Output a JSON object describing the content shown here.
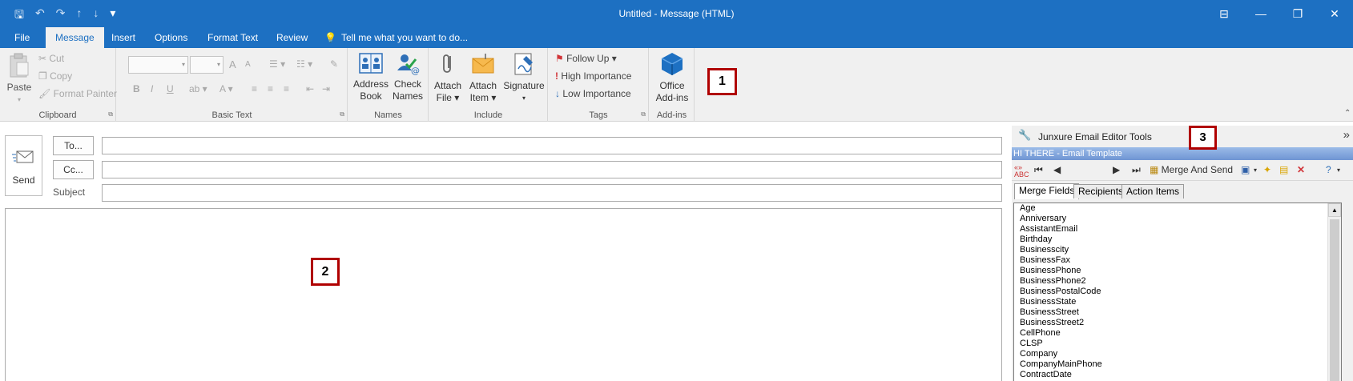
{
  "window": {
    "title": "Untitled  -  Message (HTML)",
    "qat": {
      "save": "🖫",
      "undo": "↶",
      "redo": "↷",
      "up": "↑",
      "down": "↓",
      "customize": "▾"
    },
    "controls": {
      "ribbon_display": "⊟",
      "minimize": "—",
      "restore": "❐",
      "close": "✕"
    }
  },
  "tabs": {
    "file": "File",
    "message": "Message",
    "insert": "Insert",
    "options": "Options",
    "format_text": "Format Text",
    "review": "Review",
    "tell_me": "Tell me what you want to do..."
  },
  "ribbon": {
    "clipboard": {
      "paste": "Paste",
      "cut": "Cut",
      "copy": "Copy",
      "format_painter": "Format Painter",
      "label": "Clipboard"
    },
    "basic_text": {
      "label": "Basic Text",
      "bold": "B",
      "italic": "I",
      "underline": "U",
      "grow": "A",
      "shrink": "A"
    },
    "names": {
      "address_book_1": "Address",
      "address_book_2": "Book",
      "check_names_1": "Check",
      "check_names_2": "Names",
      "label": "Names"
    },
    "include": {
      "attach_file_1": "Attach",
      "attach_file_2": "File ▾",
      "attach_item_1": "Attach",
      "attach_item_2": "Item ▾",
      "signature": "Signature",
      "signature_arrow": "▾",
      "label": "Include"
    },
    "tags": {
      "follow_up": "Follow Up ▾",
      "high_importance": "High Importance",
      "low_importance": "Low Importance",
      "label": "Tags"
    },
    "addins": {
      "office_1": "Office",
      "office_2": "Add-ins",
      "label": "Add-ins"
    }
  },
  "callouts": {
    "one": "1",
    "two": "2",
    "three": "3"
  },
  "compose": {
    "send": "Send",
    "to_button": "To...",
    "cc_button": "Cc...",
    "subject_label": "Subject",
    "to_value": "",
    "cc_value": "",
    "subject_value": ""
  },
  "pane": {
    "title": "Junxure Email Editor Tools",
    "expand": "»",
    "template_bar": "HI THERE - Email Template",
    "merge_and_send": "Merge And Send",
    "tabs": [
      "Merge Fields",
      "Recipients",
      "Action Items"
    ],
    "merge_fields": [
      "Age",
      "Anniversary",
      "AssistantEmail",
      "Birthday",
      "Businesscity",
      "BusinessFax",
      "BusinessPhone",
      "BusinessPhone2",
      "BusinessPostalCode",
      "BusinessState",
      "BusinessStreet",
      "BusinessStreet2",
      "CellPhone",
      "CLSP",
      "Company",
      "CompanyMainPhone",
      "ContractDate"
    ]
  },
  "colors": {
    "accent": "#1d70c2",
    "ribbon_bg": "#f0f0f0",
    "callout_border": "#b00000"
  }
}
